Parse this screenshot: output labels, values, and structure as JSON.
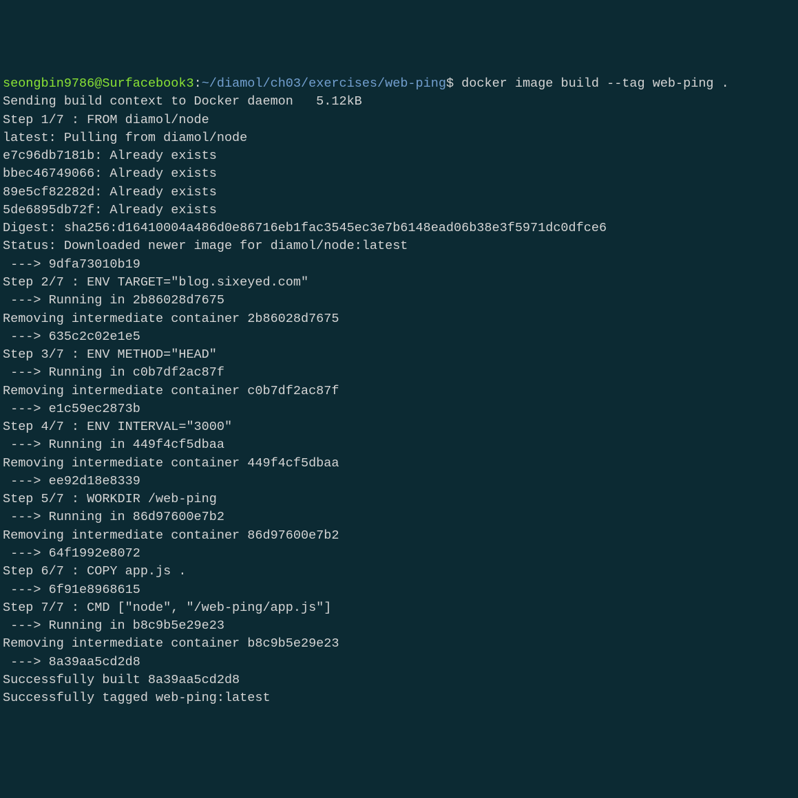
{
  "prompt": {
    "user": "seongbin9786",
    "at": "@",
    "host": "Surfacebook3",
    "colon": ":",
    "path": "~/diamol/ch03/exercises/web-ping",
    "dollar": "$ "
  },
  "command": "docker image build --tag web-ping .",
  "lines": {
    "l01": "Sending build context to Docker daemon   5.12kB",
    "l02": "Step 1/7 : FROM diamol/node",
    "l03": "latest: Pulling from diamol/node",
    "l04": "e7c96db7181b: Already exists",
    "l05": "bbec46749066: Already exists",
    "l06": "89e5cf82282d: Already exists",
    "l07": "5de6895db72f: Already exists",
    "l08": "Digest: sha256:d16410004a486d0e86716eb1fac3545ec3e7b6148ead06b38e3f5971dc0dfce6",
    "l09": "Status: Downloaded newer image for diamol/node:latest",
    "l10": " ---> 9dfa73010b19",
    "l11": "Step 2/7 : ENV TARGET=\"blog.sixeyed.com\"",
    "l12": " ---> Running in 2b86028d7675",
    "l13": "Removing intermediate container 2b86028d7675",
    "l14": " ---> 635c2c02e1e5",
    "l15": "Step 3/7 : ENV METHOD=\"HEAD\"",
    "l16": " ---> Running in c0b7df2ac87f",
    "l17": "Removing intermediate container c0b7df2ac87f",
    "l18": " ---> e1c59ec2873b",
    "l19": "Step 4/7 : ENV INTERVAL=\"3000\"",
    "l20": " ---> Running in 449f4cf5dbaa",
    "l21": "Removing intermediate container 449f4cf5dbaa",
    "l22": " ---> ee92d18e8339",
    "l23": "Step 5/7 : WORKDIR /web-ping",
    "l24": " ---> Running in 86d97600e7b2",
    "l25": "Removing intermediate container 86d97600e7b2",
    "l26": " ---> 64f1992e8072",
    "l27": "Step 6/7 : COPY app.js .",
    "l28": " ---> 6f91e8968615",
    "l29": "Step 7/7 : CMD [\"node\", \"/web-ping/app.js\"]",
    "l30": " ---> Running in b8c9b5e29e23",
    "l31": "Removing intermediate container b8c9b5e29e23",
    "l32": " ---> 8a39aa5cd2d8",
    "l33": "Successfully built 8a39aa5cd2d8",
    "l34": "Successfully tagged web-ping:latest"
  }
}
